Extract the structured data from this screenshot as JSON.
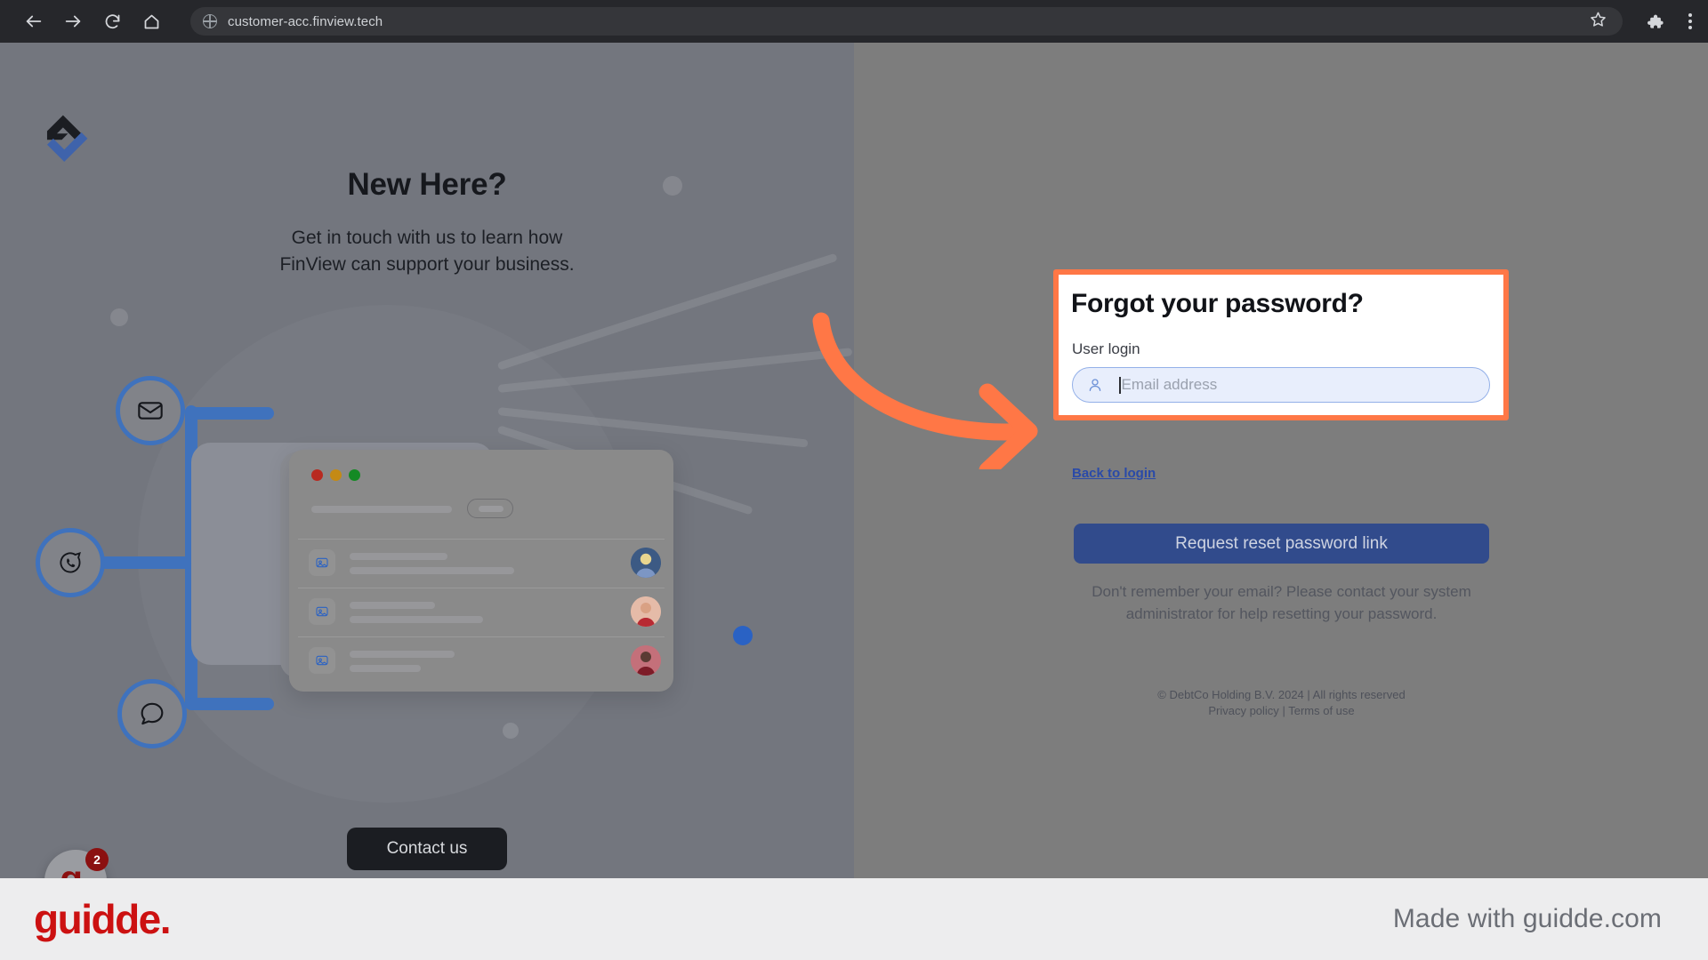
{
  "browser": {
    "back_icon": "arrow-left-icon",
    "forward_icon": "arrow-right-icon",
    "reload_icon": "reload-icon",
    "home_icon": "home-icon",
    "site_icon": "globe-icon",
    "url": "customer-acc.finview.tech",
    "bookmark_icon": "star-icon",
    "extensions_icon": "puzzle-icon",
    "menu_icon": "kebab-menu-icon",
    "chrome_bg": "#26272b",
    "url_pill_bg": "#35363a"
  },
  "left_panel": {
    "logo_name": "finview-logo",
    "logo_colors": {
      "dark": "#1b1d22",
      "blue": "#3f63ab"
    },
    "headline": "New Here?",
    "subhead_line1": "Get in touch with us to learn how",
    "subhead_line2": "FinView can support your business.",
    "contact_button": "Contact us",
    "nodes": [
      {
        "name": "mail-node",
        "icon": "envelope-icon"
      },
      {
        "name": "whatsapp-node",
        "icon": "whatsapp-icon"
      },
      {
        "name": "chat-node",
        "icon": "chat-bubble-icon"
      }
    ],
    "accent_blue": "#3f72bd",
    "background": "#73767e",
    "guidde_widget": {
      "label": "g.",
      "badge": "2"
    }
  },
  "right_panel": {
    "background": "#7d7d7d",
    "title": "Forgot your password?",
    "field_label": "User login",
    "input": {
      "name": "email-input",
      "value": "",
      "placeholder": "Email address",
      "icon": "user-icon",
      "bg": "#e8eefc",
      "border": "#93b0e8"
    },
    "back_link": "Back to login",
    "submit_button": "Request reset password link",
    "submit_color": "#314b8c",
    "help_text": "Don't remember your email? Please contact your system administrator for help resetting your password.",
    "copyright_line": "© DebtCo Holding B.V. 2024 | All rights reserved",
    "privacy_link": "Privacy policy",
    "separator": "|",
    "terms_link": "Terms of use"
  },
  "annotation": {
    "arrow_name": "orange-pointer-arrow",
    "arrow_color": "#ff7746",
    "highlight_color": "#ff7746"
  },
  "footer": {
    "brand": "guidde.",
    "brand_color": "#cc1111",
    "made_with": "Made with guidde.com",
    "background": "#ededee"
  }
}
